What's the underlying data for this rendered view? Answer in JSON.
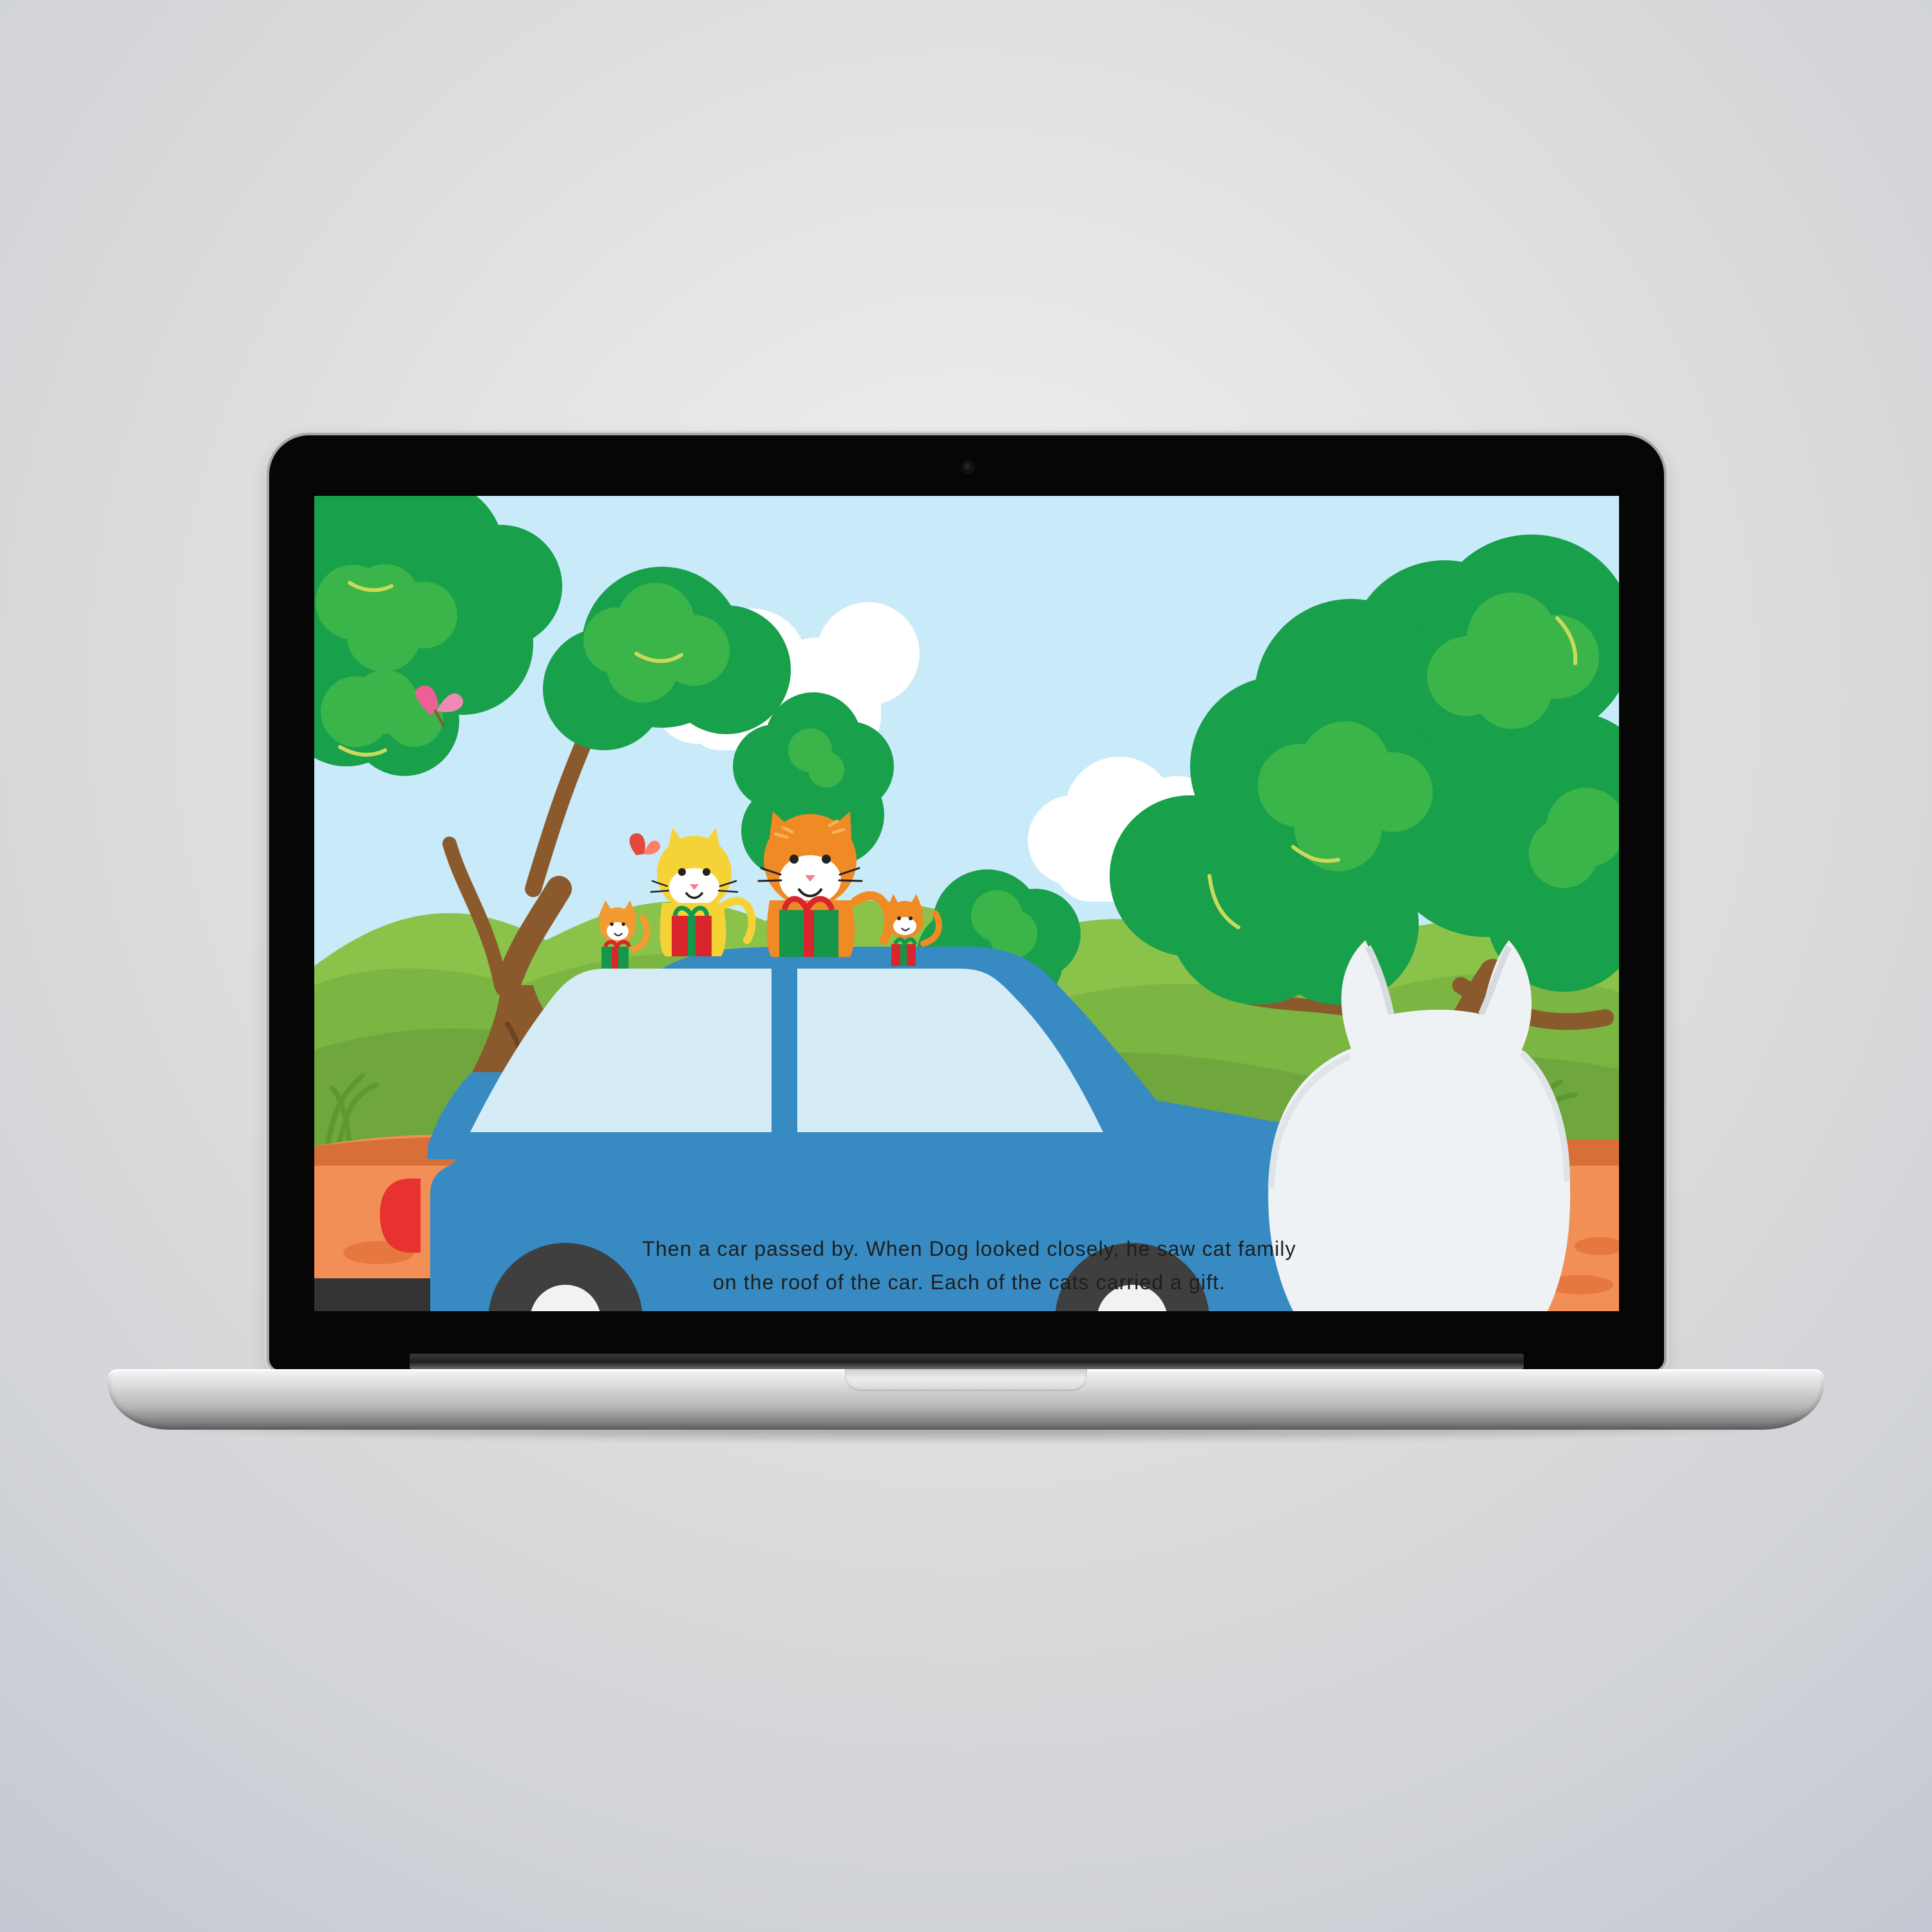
{
  "story": {
    "line1": "Then a car passed by. When Dog looked closely, he saw cat family",
    "line2": "on the roof of the car. Each of the cats carried a gift."
  },
  "colors": {
    "sky": "#c9eaf9",
    "tree_dark": "#18a04b",
    "tree_light": "#3bb44a",
    "grass": "#8bc34a",
    "road": "#f18f57",
    "car_body": "#378bc2",
    "car_window": "#d5ebf5",
    "trunk": "#8a5a2c",
    "white_pet": "#eef2f5"
  }
}
